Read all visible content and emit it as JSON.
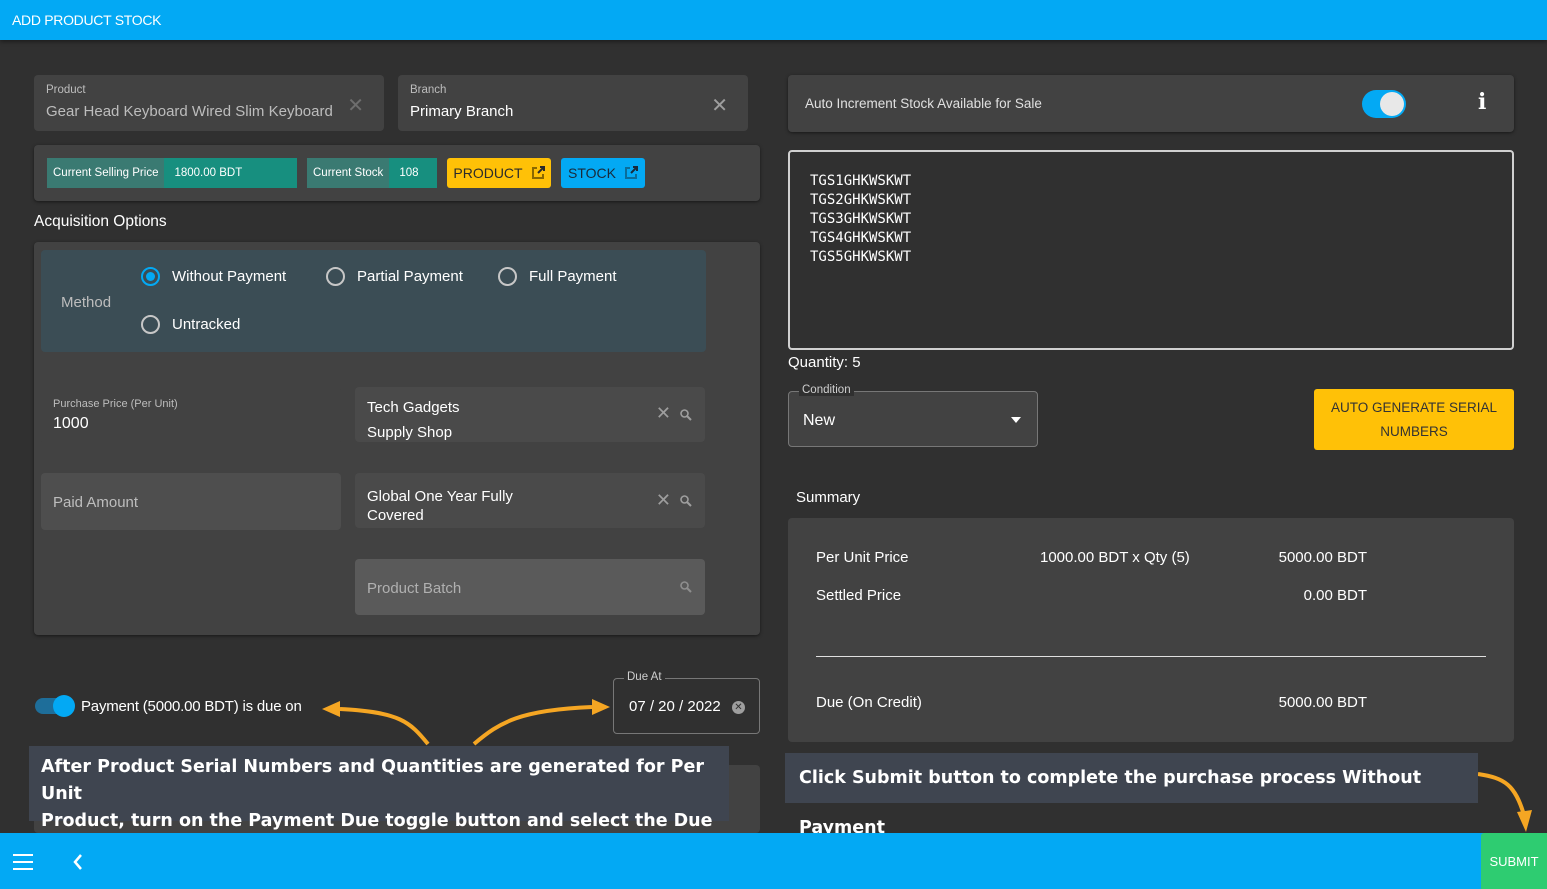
{
  "header": {
    "title": "ADD PRODUCT STOCK"
  },
  "product_field": {
    "label": "Product",
    "value": "Gear Head Keyboard Wired Slim Keyboard",
    "clear_icon": "close-icon"
  },
  "branch_field": {
    "label": "Branch",
    "value": "Primary Branch",
    "clear_icon": "close-icon"
  },
  "info_bar": {
    "selling_price_label": "Current Selling Price",
    "selling_price_value": "1800.00 BDT",
    "stock_label": "Current Stock",
    "stock_value": "108",
    "product_button": "PRODUCT",
    "stock_button": "STOCK",
    "external_link_icon": "external-link-icon"
  },
  "acquisition": {
    "title": "Acquisition Options",
    "method_label": "Method",
    "options": [
      {
        "label": "Without Payment",
        "checked": true
      },
      {
        "label": "Partial Payment",
        "checked": false
      },
      {
        "label": "Full Payment",
        "checked": false
      },
      {
        "label": "Untracked",
        "checked": false
      }
    ],
    "purchase_price_label": "Purchase Price (Per Unit)",
    "purchase_price_value": "1000",
    "paid_amount_placeholder": "Paid Amount",
    "supplier_line1": "Tech Gadgets",
    "supplier_line2": "Supply Shop",
    "warranty_line1": "Global One Year Fully",
    "warranty_line2": "Covered",
    "batch_placeholder": "Product Batch"
  },
  "payment_due": {
    "toggle_on": true,
    "text": "Payment (5000.00 BDT) is due on",
    "due_label": "Due At",
    "due_value": "07 / 20 / 2022"
  },
  "callouts": {
    "left_line1": "After Product Serial Numbers and Quantities are generated for Per Unit",
    "left_line2": "Product, turn on the Payment Due toggle button and select the Due Date",
    "right": "Click Submit button to complete the purchase process Without Payment"
  },
  "auto_increment": {
    "label": "Auto Increment Stock Available for Sale",
    "enabled": true,
    "info_icon": "info-icon"
  },
  "serials": {
    "text": "TGS1GHKWSKWT\nTGS2GHKWSKWT\nTGS3GHKWSKWT\nTGS4GHKWSKWT\nTGS5GHKWSKWT",
    "quantity_text": "Quantity: 5"
  },
  "condition": {
    "label": "Condition",
    "value": "New"
  },
  "auto_generate_button": {
    "line1": "AUTO GENERATE SERIAL",
    "line2": "NUMBERS"
  },
  "summary": {
    "title": "Summary",
    "per_unit_label": "Per Unit Price",
    "per_unit_calc": "1000.00 BDT x Qty (5)",
    "per_unit_total": "5000.00 BDT",
    "settled_label": "Settled Price",
    "settled_value": "0.00 BDT",
    "due_label": "Due (On Credit)",
    "due_value": "5000.00 BDT"
  },
  "footer": {
    "submit": "SUBMIT",
    "menu_icon": "menu-icon",
    "back_icon": "chevron-left-icon"
  },
  "colors": {
    "primary": "#03a9f4",
    "accent": "#ffc107",
    "success": "#2ecc71",
    "teal": "#178f7f",
    "annotation_arrow": "#f5a623"
  }
}
